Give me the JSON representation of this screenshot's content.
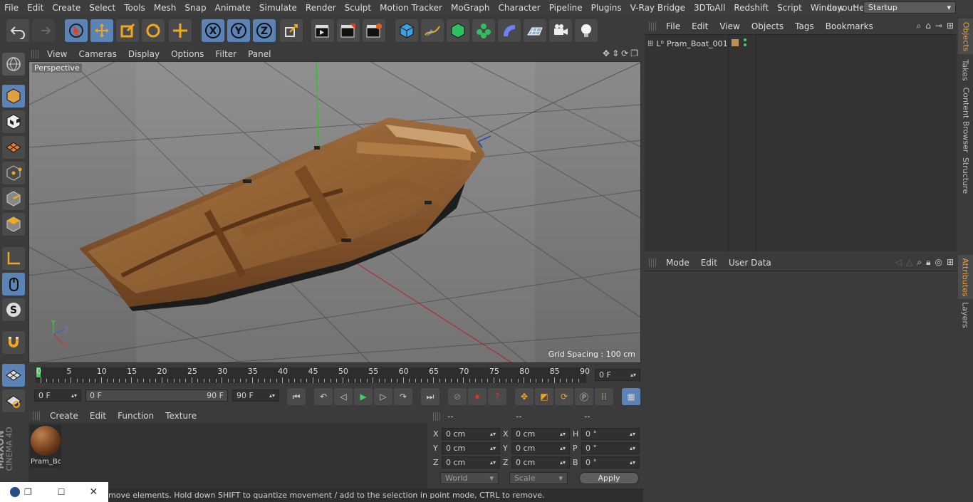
{
  "menu": [
    "File",
    "Edit",
    "Create",
    "Select",
    "Tools",
    "Mesh",
    "Snap",
    "Animate",
    "Simulate",
    "Render",
    "Sculpt",
    "Motion Tracker",
    "MoGraph",
    "Character",
    "Pipeline",
    "Plugins",
    "V-Ray Bridge",
    "3DToAll",
    "Redshift",
    "Script",
    "Window",
    "Help"
  ],
  "layout": {
    "label": "Layout:",
    "value": "Startup"
  },
  "viewport": {
    "menu": [
      "View",
      "Cameras",
      "Display",
      "Options",
      "Filter",
      "Panel"
    ],
    "camera": "Perspective",
    "grid": "Grid Spacing : 100 cm",
    "axes": {
      "y": "Y",
      "z": "Z",
      "x": "X"
    }
  },
  "timeline": {
    "ticks": [
      "0",
      "5",
      "10",
      "15",
      "20",
      "25",
      "30",
      "35",
      "40",
      "45",
      "50",
      "55",
      "60",
      "65",
      "70",
      "75",
      "80",
      "85",
      "90"
    ],
    "current": "0 F"
  },
  "transport": {
    "start": "0 F",
    "range_start": "0 F",
    "range_end": "90 F",
    "end": "90 F"
  },
  "material": {
    "menu": [
      "Create",
      "Edit",
      "Function",
      "Texture"
    ],
    "name": "Pram_Bo"
  },
  "coords": {
    "headers": [
      "--",
      "--",
      "--"
    ],
    "rows": [
      {
        "a": "X",
        "av": "0 cm",
        "b": "X",
        "bv": "0 cm",
        "c": "H",
        "cv": "0 °"
      },
      {
        "a": "Y",
        "av": "0 cm",
        "b": "Y",
        "bv": "0 cm",
        "c": "P",
        "cv": "0 °"
      },
      {
        "a": "Z",
        "av": "0 cm",
        "b": "Z",
        "bv": "0 cm",
        "c": "B",
        "cv": "0 °"
      }
    ],
    "world": "World",
    "scale": "Scale",
    "apply": "Apply"
  },
  "status": "move elements. Hold down SHIFT to quantize movement / add to the selection in point mode, CTRL to remove.",
  "objects": {
    "menu": [
      "File",
      "Edit",
      "View",
      "Objects",
      "Tags",
      "Bookmarks"
    ],
    "item": "Pram_Boat_001"
  },
  "attributes": {
    "menu": [
      "Mode",
      "Edit",
      "User Data"
    ]
  },
  "sidetabs": {
    "top": [
      "Objects",
      "Takes",
      "Content Browser",
      "Structure"
    ],
    "bottom": [
      "Attributes",
      "Layers"
    ]
  },
  "brand": {
    "maxon": "MAXON",
    "c4d": "CINEMA 4D"
  }
}
